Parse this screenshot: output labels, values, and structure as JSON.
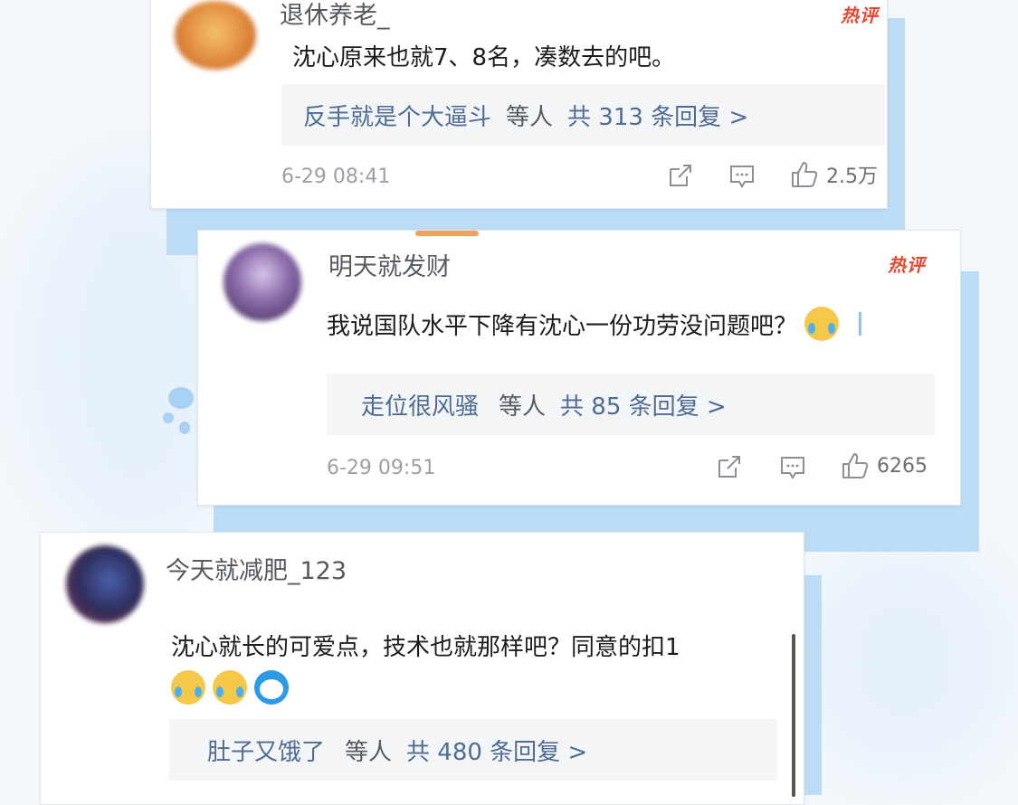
{
  "comments": [
    {
      "username": "退休养老_",
      "hot_badge": "热评",
      "text": "沈心原来也就7、8名，凑数去的吧。",
      "reply": {
        "user": "反手就是个大逼斗",
        "mid": "等人",
        "count": "共 313 条回复 >"
      },
      "timestamp": "6-29 08:41",
      "likes": "2.5万"
    },
    {
      "username": "明天就发财",
      "hot_badge": "热评",
      "text": "我说国队水平下降有沈心一份功劳没问题吧？",
      "reply": {
        "user": "走位很风骚",
        "mid": "等人",
        "count": "共 85 条回复 >"
      },
      "timestamp": "6-29 09:51",
      "likes": "6265"
    },
    {
      "username": "今天就减肥_123",
      "text": "沈心就长的可爱点，技术也就那样吧？同意的扣1",
      "reply": {
        "user": "肚子又饿了",
        "mid": "等人",
        "count": "共 480 条回复 >"
      }
    }
  ],
  "colors": {
    "accent_link": "#4e6c95",
    "hot": "#e8472f",
    "shadow_blue": "#bcdcf6"
  },
  "icons": [
    "share-icon",
    "comment-icon",
    "like-icon",
    "cry-laugh-emoji",
    "doraemon-emoji"
  ]
}
